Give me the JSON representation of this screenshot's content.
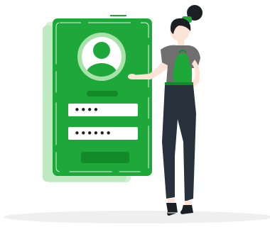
{
  "colors": {
    "accent": "#1ea83a",
    "accent_dark": "#138a2a",
    "accent_light": "#a7e2a9",
    "accent_pale": "#d3f0d4",
    "skin": "#fbe3d6",
    "hair": "#1c1f24",
    "shirt": "#6f6f6f",
    "pants": "#28323d",
    "ground": "#eeeeee"
  },
  "login_card": {
    "avatar_icon": "user-avatar-icon",
    "password_field_1": "••••",
    "password_field_2": "••••••"
  }
}
